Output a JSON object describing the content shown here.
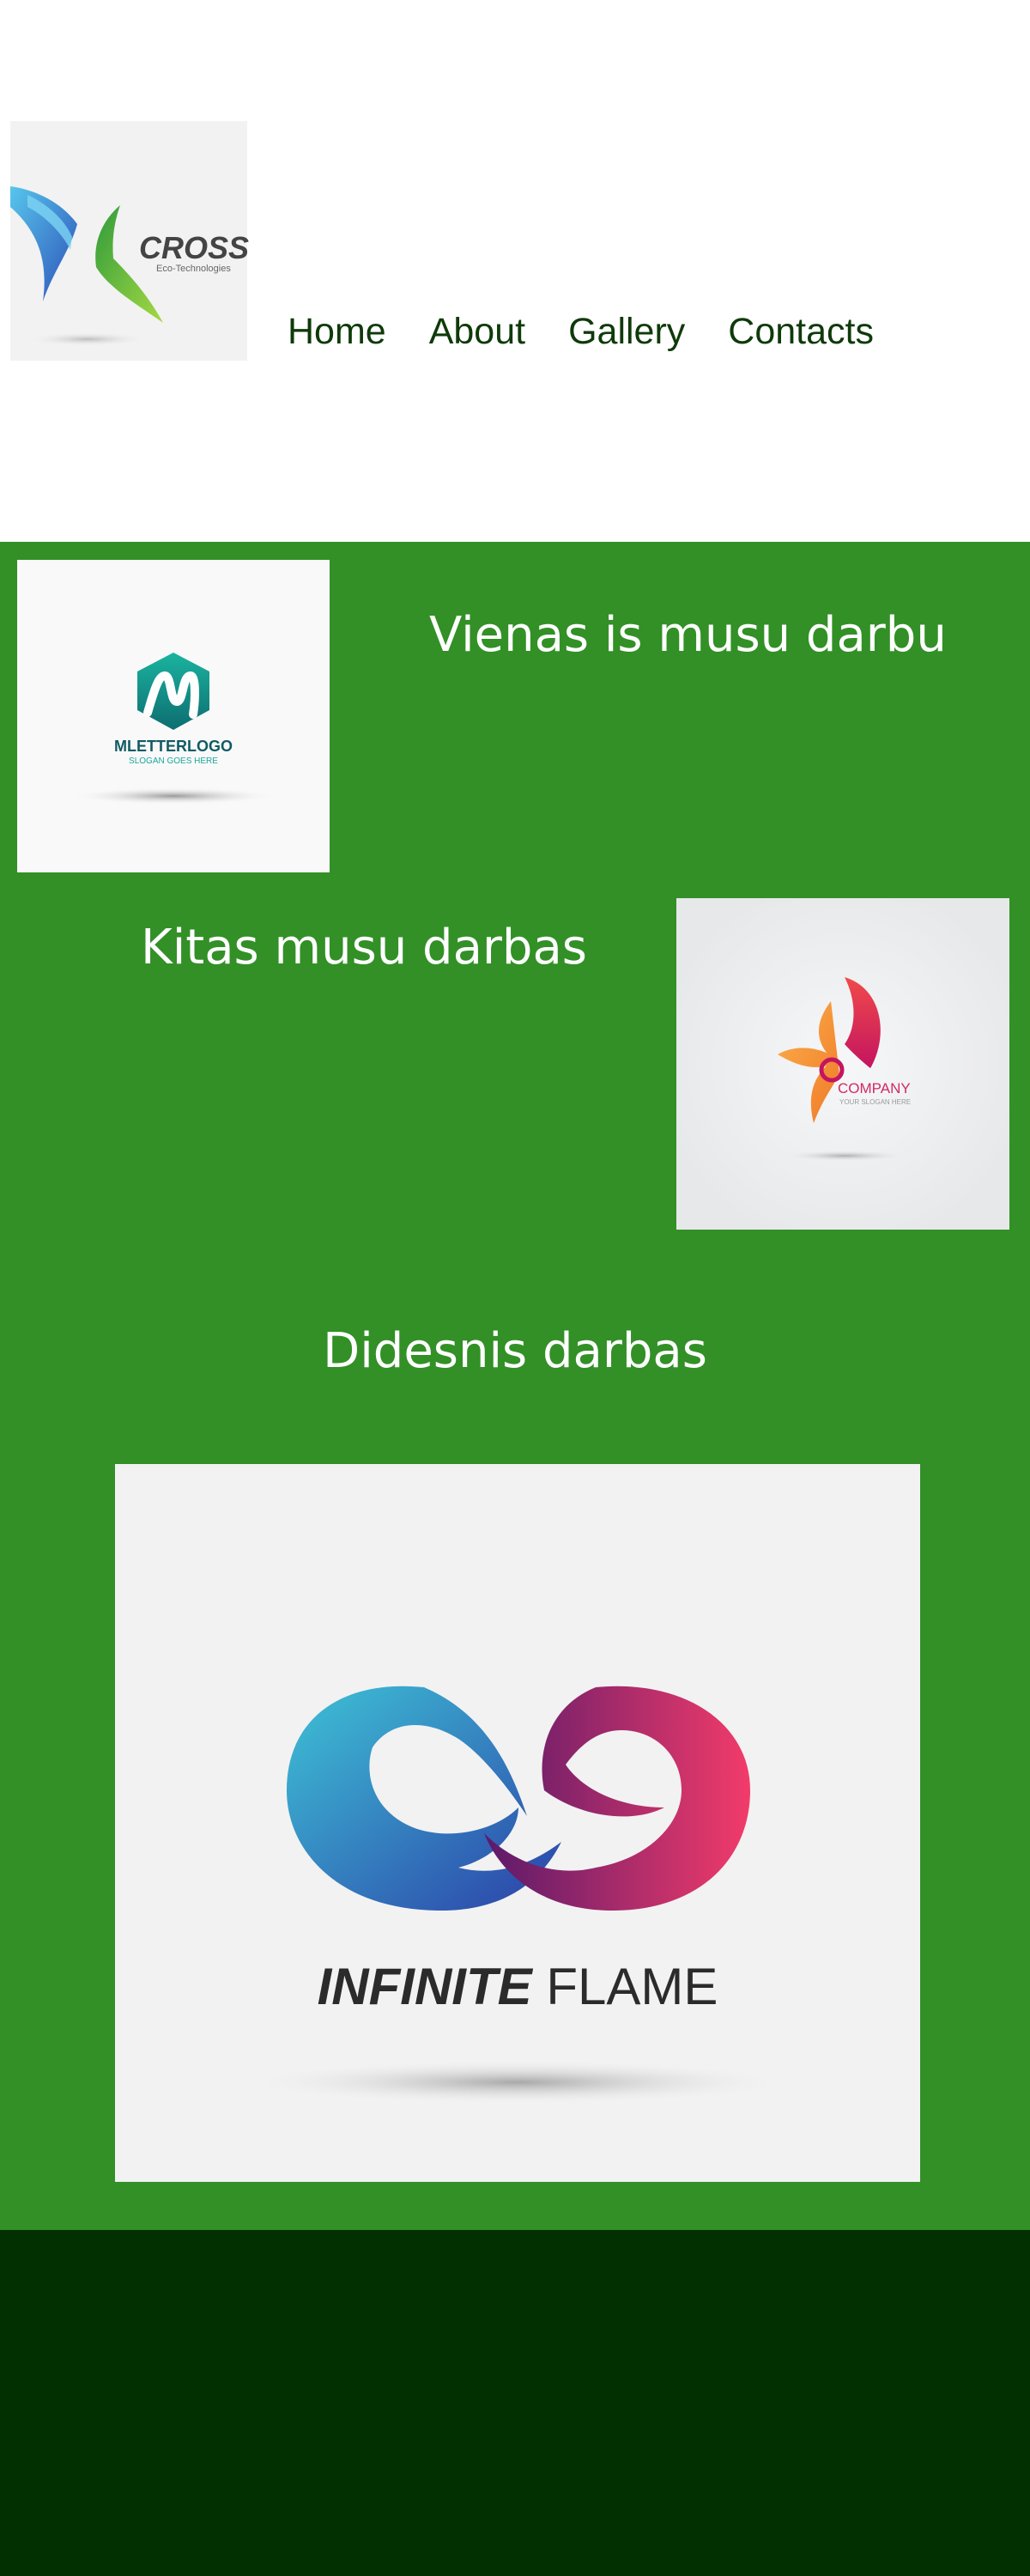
{
  "header": {
    "logo": {
      "name": "CROSS",
      "tagline": "Eco-Technologies"
    },
    "nav": [
      {
        "label": "Home"
      },
      {
        "label": "About"
      },
      {
        "label": "Gallery"
      },
      {
        "label": "Contacts"
      }
    ]
  },
  "main": {
    "works": [
      {
        "title": "Vienas is musu darbu",
        "image": {
          "brand": "MLETTERLOGO",
          "slogan": "SLOGAN GOES HERE"
        }
      },
      {
        "title": "Kitas musu darbas",
        "image": {
          "brand": "COMPANY",
          "slogan": "YOUR SLOGAN HERE"
        }
      },
      {
        "title": "Didesnis darbas",
        "image": {
          "brand_bold": "INFINITE",
          "brand_light": "FLAME"
        }
      }
    ]
  },
  "colors": {
    "main_bg": "#329026",
    "footer_bg": "#023001",
    "nav_text": "#0f3a0a",
    "heading_text": "#ffffff"
  }
}
